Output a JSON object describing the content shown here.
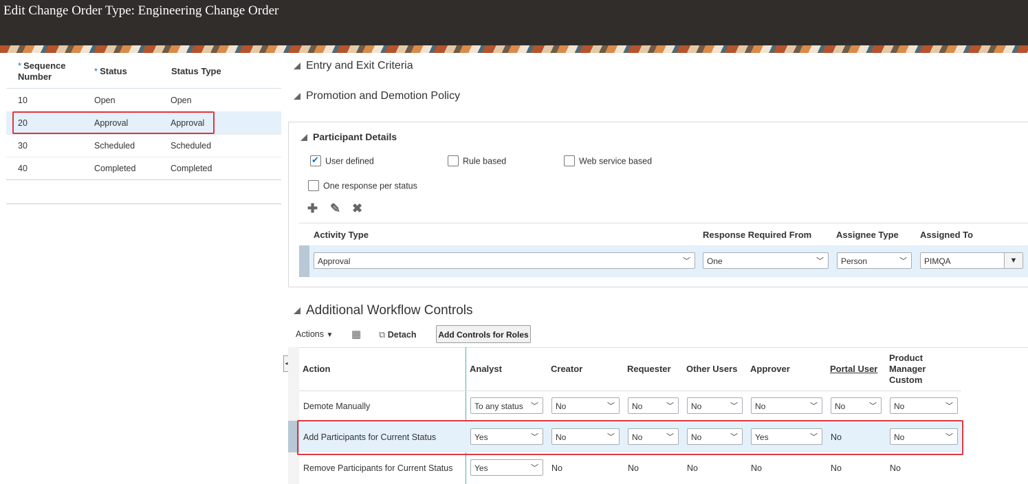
{
  "page": {
    "title": "Edit Change Order Type: Engineering Change Order"
  },
  "status_table": {
    "headers": {
      "seq": "Sequence Number",
      "status": "Status",
      "type": "Status Type",
      "required_marker": "*"
    },
    "rows": [
      {
        "seq": "10",
        "status": "Open",
        "type": "Open"
      },
      {
        "seq": "20",
        "status": "Approval",
        "type": "Approval"
      },
      {
        "seq": "30",
        "status": "Scheduled",
        "type": "Scheduled"
      },
      {
        "seq": "40",
        "status": "Completed",
        "type": "Completed"
      }
    ]
  },
  "sections": {
    "entry_exit": "Entry and Exit Criteria",
    "promotion": "Promotion and Demotion Policy",
    "participants": "Participant Details",
    "workflow": "Additional Workflow Controls"
  },
  "participants": {
    "options": {
      "user_defined": "User defined",
      "rule_based": "Rule based",
      "web_service": "Web service based",
      "one_response": "One response per status"
    },
    "headers": {
      "activity": "Activity Type",
      "response": "Response Required From",
      "assignee": "Assignee Type",
      "assigned": "Assigned To"
    },
    "row": {
      "activity": "Approval",
      "response": "One",
      "assignee": "Person",
      "assigned": "PIMQA"
    }
  },
  "workflow": {
    "toolbar": {
      "actions": "Actions",
      "detach": "Detach",
      "add_controls": "Add Controls for Roles"
    },
    "headers": {
      "action": "Action",
      "analyst": "Analyst",
      "creator": "Creator",
      "requester": "Requester",
      "other": "Other Users",
      "approver": "Approver",
      "portal": "Portal User",
      "pm1": "Product",
      "pm2": "Manager",
      "pm3": "Custom"
    },
    "rows": [
      {
        "action": "Demote Manually",
        "analyst": "To any status",
        "creator": "No",
        "requester": "No",
        "other": "No",
        "approver": "No",
        "portal": "No",
        "pm": "No"
      },
      {
        "action": "Add Participants for Current Status",
        "analyst": "Yes",
        "creator": "No",
        "requester": "No",
        "other": "No",
        "approver": "Yes",
        "portal": "No",
        "pm": "No"
      },
      {
        "action": "Remove Participants for Current Status",
        "analyst": "Yes",
        "creator": "No",
        "requester": "No",
        "other": "No",
        "approver": "No",
        "portal": "No",
        "pm": "No"
      }
    ]
  }
}
